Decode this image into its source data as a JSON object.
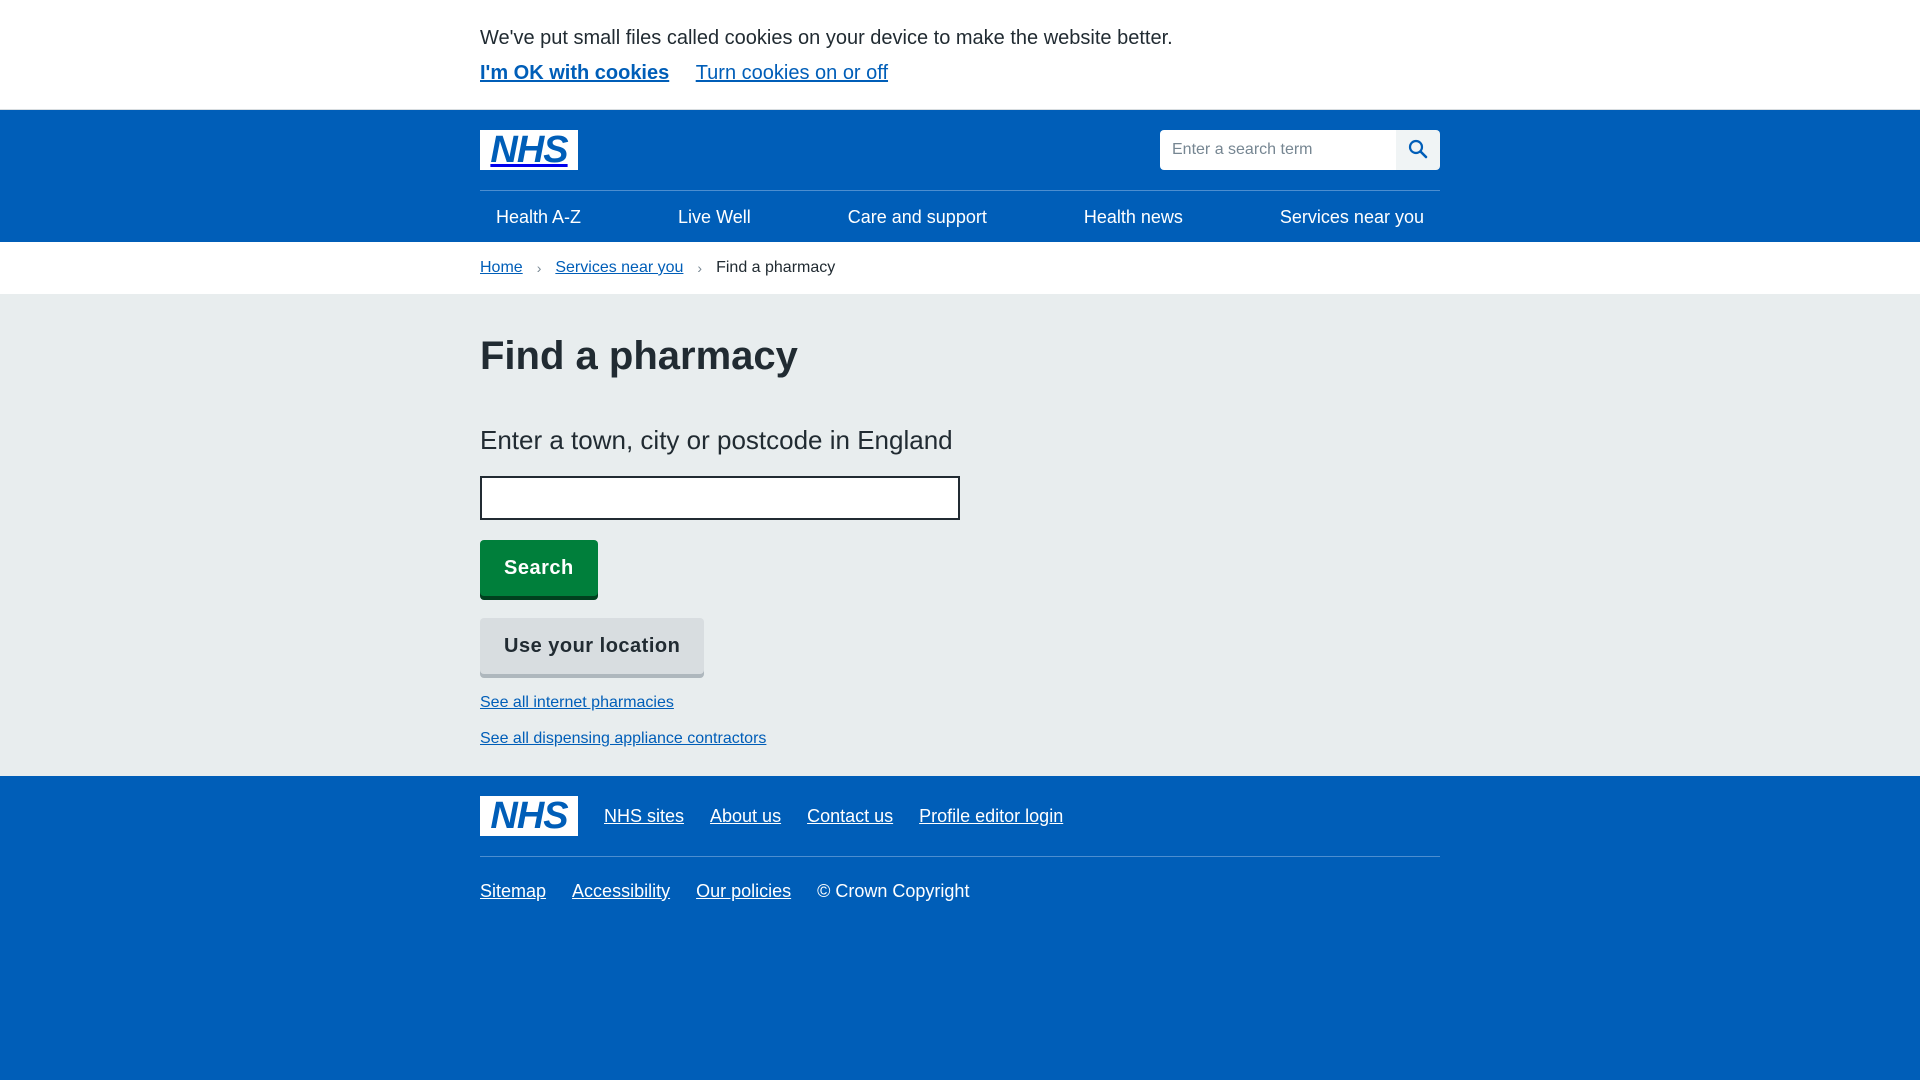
{
  "cookie": {
    "message": "We've put small files called cookies on your device to make the website better.",
    "accept_label": "I'm OK with cookies",
    "settings_label": "Turn cookies on or off"
  },
  "header": {
    "logo_text": "NHS",
    "search_placeholder": "Enter a search term",
    "search_icon": "search-icon",
    "nav": [
      {
        "label": "Health A-Z"
      },
      {
        "label": "Live Well"
      },
      {
        "label": "Care and support"
      },
      {
        "label": "Health news"
      },
      {
        "label": "Services near you"
      }
    ]
  },
  "breadcrumb": {
    "items": [
      {
        "label": "Home"
      },
      {
        "label": "Services near you"
      }
    ],
    "current": "Find a pharmacy"
  },
  "main": {
    "title": "Find a pharmacy",
    "input_label": "Enter a town, city or postcode in England",
    "input_value": "",
    "search_button": "Search",
    "location_button": "Use your location",
    "links": [
      {
        "label": "See all internet pharmacies"
      },
      {
        "label": "See all dispensing appliance contractors"
      }
    ]
  },
  "footer": {
    "logo_text": "NHS",
    "top_links": [
      {
        "label": "NHS sites"
      },
      {
        "label": "About us"
      },
      {
        "label": "Contact us"
      },
      {
        "label": "Profile editor login"
      }
    ],
    "bottom_links": [
      {
        "label": "Sitemap"
      },
      {
        "label": "Accessibility"
      },
      {
        "label": "Our policies"
      }
    ],
    "copyright": "© Crown Copyright"
  },
  "colors": {
    "nhs_blue": "#005eb8",
    "search_green": "#007f3b",
    "page_grey": "#e8edee"
  }
}
